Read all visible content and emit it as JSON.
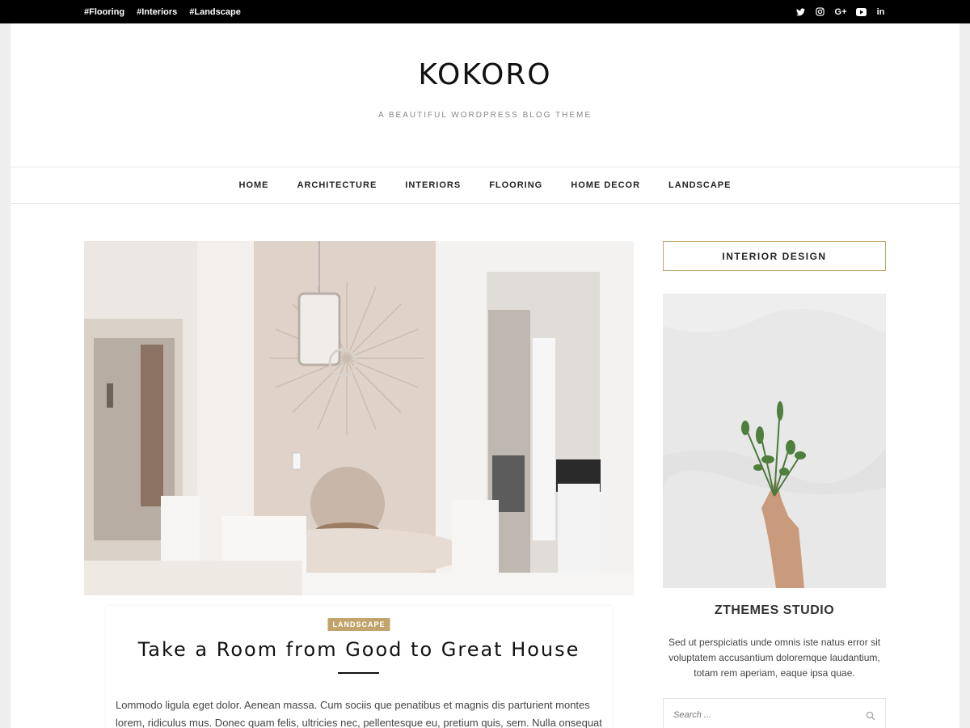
{
  "topbar": {
    "tags": [
      "#Flooring",
      "#Interiors",
      "#Landscape"
    ],
    "social_icons": [
      "twitter-icon",
      "instagram-icon",
      "google-plus-icon",
      "youtube-icon",
      "linkedin-icon"
    ],
    "google_plus_text": "G+",
    "linkedin_text": "in"
  },
  "site": {
    "title": "KOKORO",
    "tagline": "A BEAUTIFUL WORDPRESS BLOG THEME"
  },
  "nav": {
    "items": [
      "HOME",
      "ARCHITECTURE",
      "INTERIORS",
      "FLOORING",
      "HOME DECOR",
      "LANDSCAPE"
    ]
  },
  "post": {
    "category": "LANDSCAPE",
    "title": "Take a Room from Good to Great House",
    "excerpt": "Lommodo ligula eget dolor. Aenean massa. Cum sociis que penatibus et magnis dis parturient montes lorem, ridiculus mus. Donec quam felis, ultricies nec, pellentesque eu, pretium quis, sem. Nulla onsequat massa quis"
  },
  "sidebar": {
    "widget_title": "INTERIOR DESIGN",
    "studio_name": "ZTHEMES STUDIO",
    "studio_text": "Sed ut perspiciatis unde omnis iste natus error sit voluptatem accusantium doloremque laudantium, totam rem aperiam, eaque ipsa quae.",
    "search_placeholder": "Search ..."
  },
  "colors": {
    "accent": "#c0a46b",
    "topbar": "#000000",
    "page_bg": "#eeeeee"
  }
}
